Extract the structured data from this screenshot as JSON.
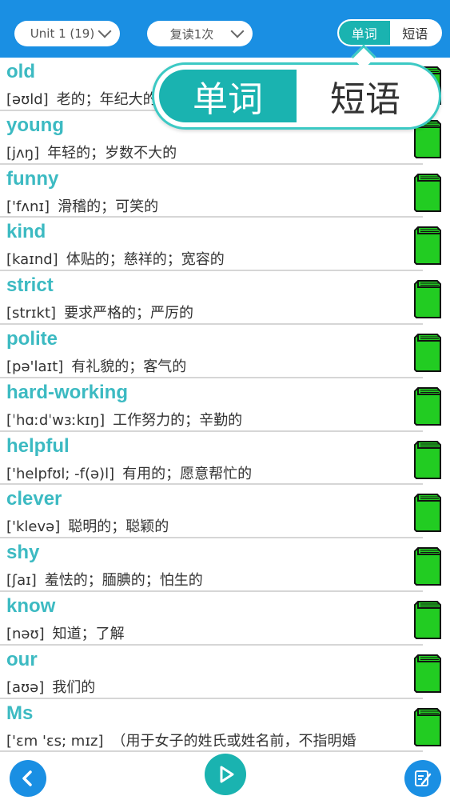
{
  "header": {
    "unit_select": "Unit 1 (19)",
    "mode_select": "复读1次",
    "tabs": [
      "单词",
      "短语"
    ]
  },
  "popup": {
    "tabs": [
      "单词",
      "短语"
    ]
  },
  "words": [
    {
      "word": "old",
      "phonetic": "[əʊld]",
      "meaning": "老的；年纪大的"
    },
    {
      "word": "young",
      "phonetic": "[jʌŋ]",
      "meaning": "年轻的；岁数不大的"
    },
    {
      "word": "funny",
      "phonetic": "['fʌnɪ]",
      "meaning": "滑稽的；可笑的"
    },
    {
      "word": "kind",
      "phonetic": "[kaɪnd]",
      "meaning": "体贴的；慈祥的；宽容的"
    },
    {
      "word": "strict",
      "phonetic": "[strɪkt]",
      "meaning": "要求严格的；严厉的"
    },
    {
      "word": "polite",
      "phonetic": "[pə'laɪt]",
      "meaning": "有礼貌的；客气的"
    },
    {
      "word": "hard-working",
      "phonetic": "[ˈhɑːdˈwɜːkɪŋ]",
      "meaning": "工作努力的；辛勤的"
    },
    {
      "word": "helpful",
      "phonetic": "['helpfʊl; -f(ə)l]",
      "meaning": "有用的；愿意帮忙的"
    },
    {
      "word": "clever",
      "phonetic": "['klevə]",
      "meaning": "聪明的；聪颖的"
    },
    {
      "word": "shy",
      "phonetic": "[ʃaɪ]",
      "meaning": "羞怯的；腼腆的；怕生的"
    },
    {
      "word": "know",
      "phonetic": "[nəʊ]",
      "meaning": "知道；了解"
    },
    {
      "word": "our",
      "phonetic": "[aʊə]",
      "meaning": "我们的"
    },
    {
      "word": "Ms",
      "phonetic": "['ɛm 'ɛs; mɪz]",
      "meaning": "（用于女子的姓氏或姓名前，不指明婚"
    }
  ],
  "colors": {
    "header_bg": "#1a8fe3",
    "accent": "#1ab3b0",
    "word_text": "#3cbac2",
    "book_fill": "#22cc22"
  },
  "icons": {
    "back": "back-arrow-icon",
    "play": "play-icon",
    "edit": "edit-note-icon",
    "book": "book-icon"
  }
}
